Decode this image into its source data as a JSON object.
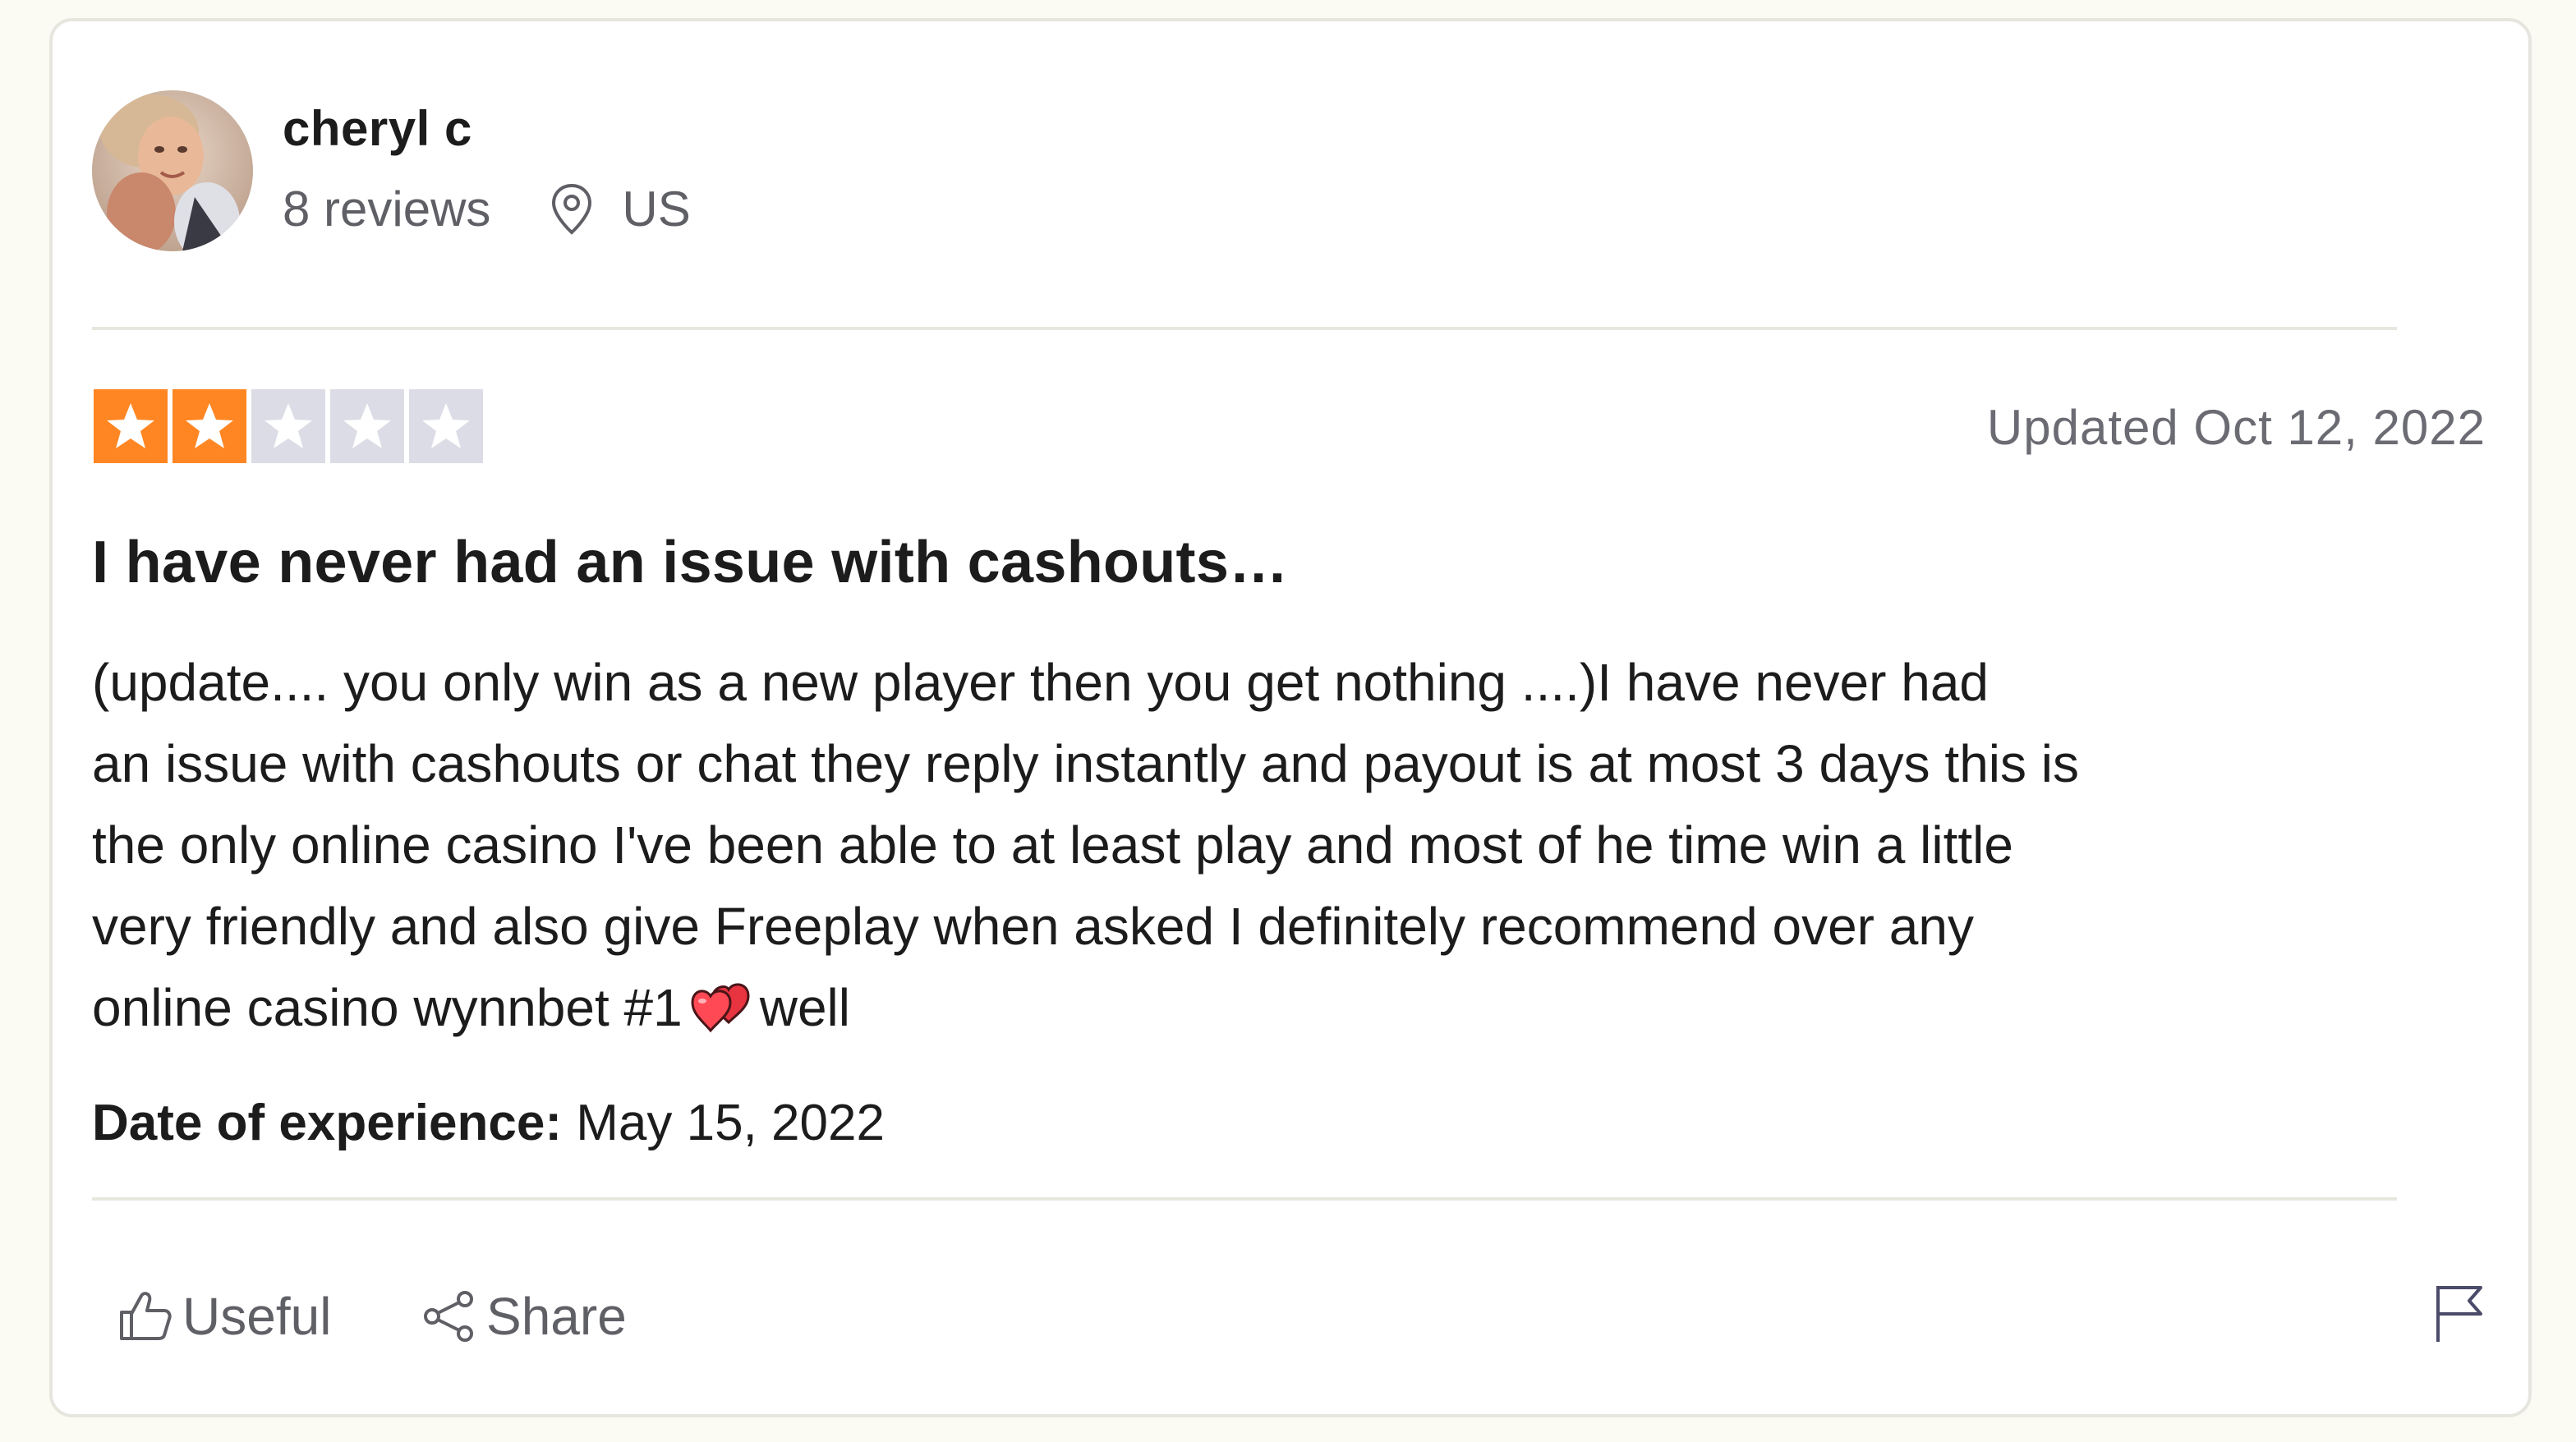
{
  "consumer": {
    "name": "cheryl c",
    "reviews": "8 reviews",
    "country": "US"
  },
  "review": {
    "rating": 2,
    "max_rating": 5,
    "updated": "Updated Oct 12, 2022",
    "title": "I have never had an issue with cashouts…",
    "body_lines": [
      "(update.... you only win as a new player then you get nothing ....)I have never had",
      "an issue with cashouts or chat they reply instantly and payout is at most 3 days this is",
      "the only online casino I've been able to at least play and most of he time win a little",
      "very friendly and also give Freeplay when asked I definitely recommend over any"
    ],
    "body_last_line_before": "online casino wynnbet #1",
    "body_last_line_after": "well",
    "experience_label": "Date of experience:",
    "experience_date": "May 15, 2022"
  },
  "actions": {
    "useful": "Useful",
    "share": "Share"
  },
  "colors": {
    "star_filled": "#ff8622",
    "star_empty": "#dcdce6",
    "background": "#fbfaf3"
  },
  "icons": {
    "location": "location-pin-icon",
    "useful": "thumbs-up-icon",
    "share": "share-icon",
    "report": "flag-icon",
    "emoji": "two-hearts-icon"
  }
}
